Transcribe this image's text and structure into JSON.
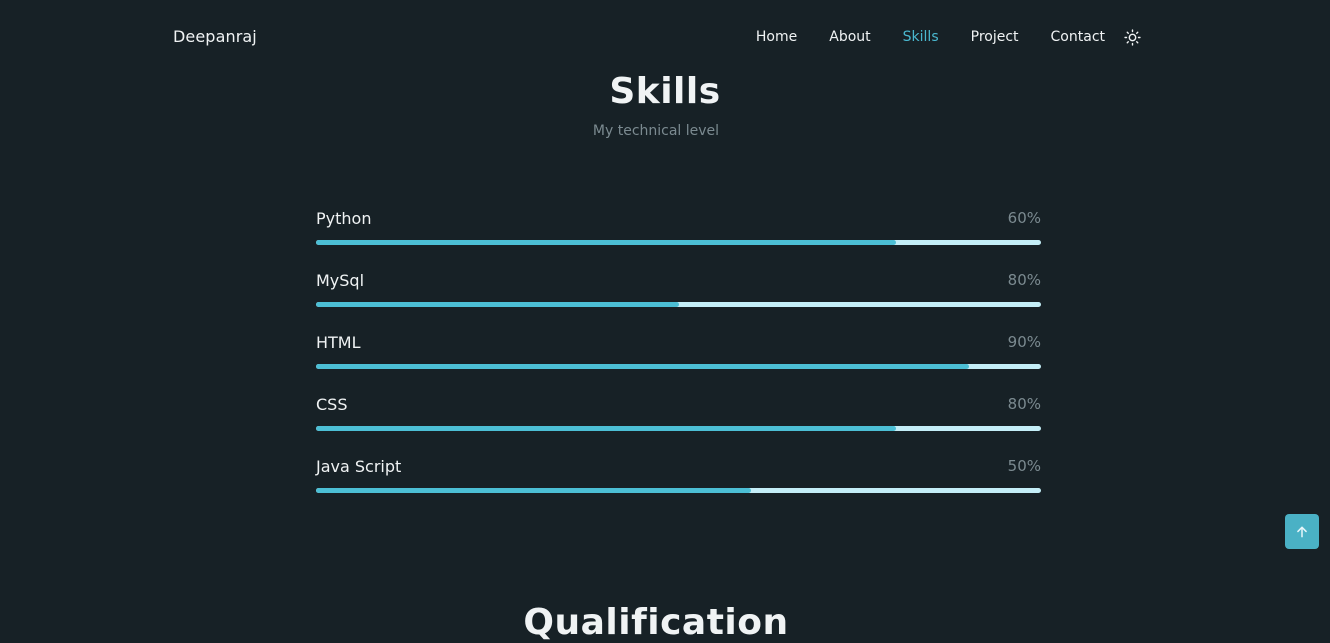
{
  "header": {
    "logo": "Deepanraj",
    "nav": [
      {
        "label": "Home",
        "active": false
      },
      {
        "label": "About",
        "active": false
      },
      {
        "label": "Skills",
        "active": true
      },
      {
        "label": "Project",
        "active": false
      },
      {
        "label": "Contact",
        "active": false
      }
    ],
    "theme_icon": "sun-icon"
  },
  "skills_section": {
    "title": "Skills",
    "subtitle": "My technical level",
    "items": [
      {
        "name": "Python",
        "percent_label": "60%",
        "fill_fraction": 0.8
      },
      {
        "name": "MySql",
        "percent_label": "80%",
        "fill_fraction": 0.5
      },
      {
        "name": "HTML",
        "percent_label": "90%",
        "fill_fraction": 0.9
      },
      {
        "name": "CSS",
        "percent_label": "80%",
        "fill_fraction": 0.8
      },
      {
        "name": "Java Script",
        "percent_label": "50%",
        "fill_fraction": 0.6
      }
    ]
  },
  "scroll_up": {
    "icon": "arrow-up-icon"
  },
  "next_section": {
    "title": "Qualification"
  },
  "colors": {
    "background": "#172126",
    "accent": "#4ab8cf",
    "bar_fill": "#4cbfd5",
    "bar_track": "#c4eef7",
    "text": "#f0f3f4",
    "muted_text": "#7b8a90"
  }
}
